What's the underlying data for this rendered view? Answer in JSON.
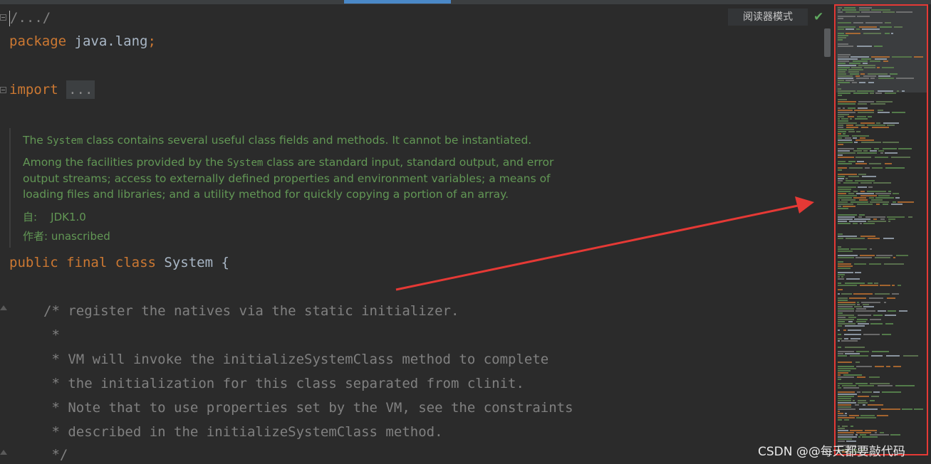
{
  "editor": {
    "header_comment": "/.../",
    "package_keyword": "package",
    "package_name": " java.lang",
    "package_semicolon": ";",
    "import_keyword": "import",
    "import_collapsed": "...",
    "class_decl": {
      "kw_public": "public",
      "kw_final": "final",
      "kw_class": "class",
      "name": "System",
      "brace": "{"
    },
    "comment_lines": [
      "/* register the natives via the static initializer.",
      " *",
      " * VM will invoke the initializeSystemClass method to complete",
      " * the initialization for this class separated from clinit.",
      " * Note that to use properties set by the VM, see the constraints",
      " * described in the initializeSystemClass method.",
      " */"
    ]
  },
  "javadoc": {
    "p1_a": "The ",
    "p1_code": "System",
    "p1_b": " class contains several useful class fields and methods. It cannot be instantiated.",
    "p2_a": "Among the facilities provided by the ",
    "p2_code": "System",
    "p2_b": " class are standard input, standard output, and error output streams; access to externally defined properties and environment variables; a means of loading files and libraries; and a utility method for quickly copying a portion of an array.",
    "since_label": "自:",
    "since_value": "JDK1.0",
    "author_label": "作者:",
    "author_value": "unascribed"
  },
  "toolbar": {
    "reader_mode_label": "阅读器模式",
    "status_check_icon": "check-icon"
  },
  "watermark": "CSDN @@每天都要敲代码",
  "colors": {
    "background": "#2b2b2b",
    "keyword": "#cc7832",
    "comment": "#808080",
    "javadoc": "#629755",
    "identifier": "#a9b7c6",
    "annotation_red": "#e53935"
  }
}
